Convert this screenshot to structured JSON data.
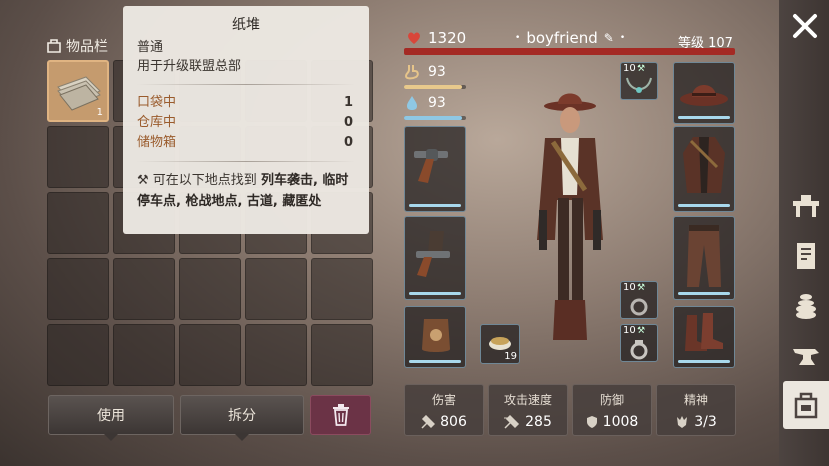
{
  "inventory": {
    "title": "物品栏",
    "slot_qty": "1",
    "use_label": "使用",
    "split_label": "拆分"
  },
  "tooltip": {
    "title": "纸堆",
    "rarity": "普通",
    "description": "用于升级联盟总部",
    "rows": [
      {
        "label": "口袋中",
        "value": "1"
      },
      {
        "label": "仓库中",
        "value": "0"
      },
      {
        "label": "储物箱",
        "value": "0"
      }
    ],
    "where_prefix": "可在以下地点找到",
    "where_locations": "列车袭击, 临时停车点, 枪战地点, 古道, 藏匿处"
  },
  "character": {
    "health": "1320",
    "name": "boyfriend",
    "level": "等级 107",
    "food": "93",
    "water": "93",
    "food_pct": 0.93,
    "water_pct": 0.93,
    "ammo_count": "19",
    "acc1_level": "10",
    "acc2_level": "10",
    "acc3_level": "10"
  },
  "stats": [
    {
      "label": "伤害",
      "value": "806",
      "icon": "damage-icon"
    },
    {
      "label": "攻击速度",
      "value": "285",
      "icon": "speed-icon"
    },
    {
      "label": "防御",
      "value": "1008",
      "icon": "defense-icon"
    },
    {
      "label": "精神",
      "value": "3/3",
      "icon": "spirit-icon"
    }
  ],
  "colors": {
    "health_bar": "#a42a24",
    "food_bar": "#e8c98c",
    "water_bar": "#8fc8e4",
    "selected_slot": "#c59b6e",
    "trash_button": "#6b3346"
  }
}
